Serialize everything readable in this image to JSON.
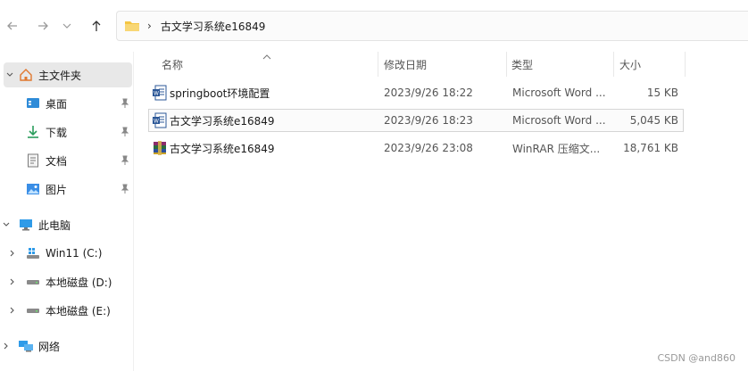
{
  "nav": {
    "back_icon": "arrow-left-icon",
    "forward_icon": "arrow-right-icon",
    "recent_icon": "chevron-down-icon",
    "up_icon": "arrow-up-icon"
  },
  "address": {
    "separator": "›",
    "path": "古文学习系统e16849"
  },
  "sidebar": {
    "home": "主文件夹",
    "quick": [
      {
        "label": "桌面",
        "icon": "desktop-icon"
      },
      {
        "label": "下载",
        "icon": "download-icon"
      },
      {
        "label": "文档",
        "icon": "document-icon"
      },
      {
        "label": "图片",
        "icon": "pictures-icon"
      }
    ],
    "this_pc": "此电脑",
    "drives": [
      {
        "label": "Win11 (C:)",
        "icon": "windows-drive-icon"
      },
      {
        "label": "本地磁盘 (D:)",
        "icon": "drive-icon"
      },
      {
        "label": "本地磁盘 (E:)",
        "icon": "drive-icon"
      }
    ],
    "network": "网络"
  },
  "columns": {
    "name": "名称",
    "modified": "修改日期",
    "type": "类型",
    "size": "大小"
  },
  "files": [
    {
      "name": "springboot环境配置",
      "modified": "2023/9/26 18:22",
      "type": "Microsoft Word ...",
      "size": "15 KB",
      "icon": "word-icon"
    },
    {
      "name": "古文学习系统e16849",
      "modified": "2023/9/26 18:23",
      "type": "Microsoft Word ...",
      "size": "5,045 KB",
      "icon": "word-icon"
    },
    {
      "name": "古文学习系统e16849",
      "modified": "2023/9/26 23:08",
      "type": "WinRAR 压缩文...",
      "size": "18,761 KB",
      "icon": "winrar-icon"
    }
  ],
  "watermark": "CSDN @and860",
  "colors": {
    "folder": "#f4c542",
    "word_blue": "#2b5797",
    "selection_bg": "#e8e8e8",
    "home_orange": "#e0782f"
  }
}
